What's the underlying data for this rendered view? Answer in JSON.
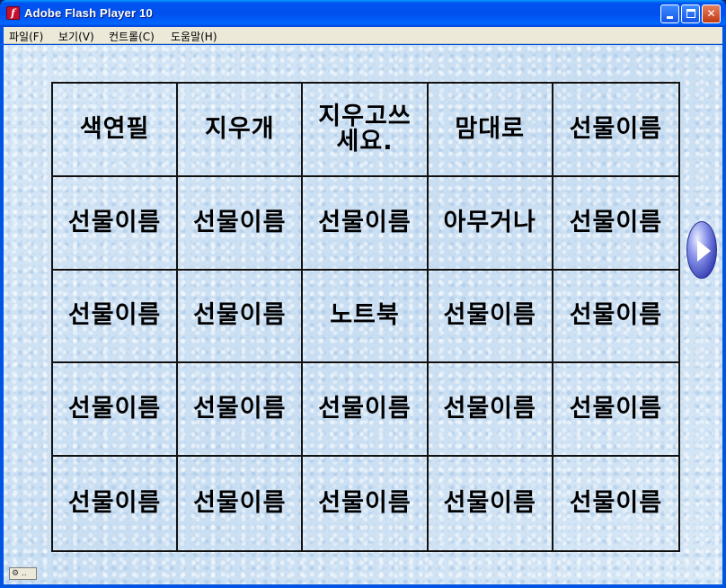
{
  "window": {
    "title": "Adobe Flash Player 10",
    "app_icon_glyph": "f",
    "controls": {
      "minimize": "",
      "maximize": "",
      "close": "✕"
    }
  },
  "menubar": {
    "items": [
      {
        "label": "파일(F)"
      },
      {
        "label": "보기(V)"
      },
      {
        "label": "컨트롤(C)"
      },
      {
        "label": "도움말(H)"
      }
    ]
  },
  "board": {
    "cells": [
      "색연필",
      "지우개",
      "지우고쓰\n세요.",
      "맘대로",
      "선물이름",
      "선물이름",
      "선물이름",
      "선물이름",
      "아무거나",
      "선물이름",
      "선물이름",
      "선물이름",
      "노트북",
      "선물이름",
      "선물이름",
      "선물이름",
      "선물이름",
      "선물이름",
      "선물이름",
      "선물이름",
      "선물이름",
      "선물이름",
      "선물이름",
      "선물이름",
      "선물이름"
    ]
  },
  "next_button": {
    "icon": "play-arrow-icon"
  },
  "colors": {
    "titlebar": "#0054e3",
    "stage_background": "#cfe2f3",
    "grid_line": "#111111"
  }
}
